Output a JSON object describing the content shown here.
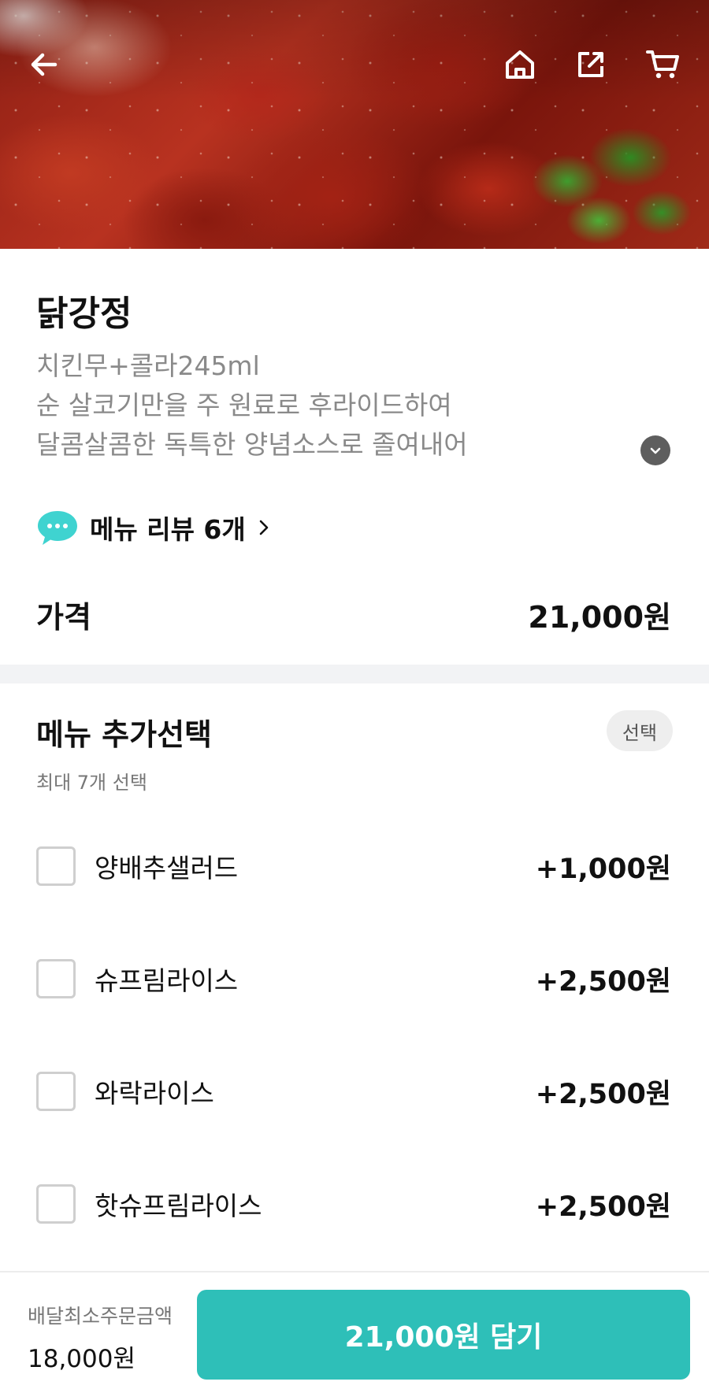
{
  "header": {
    "back_icon": "arrow-left-icon",
    "home_icon": "home-icon",
    "share_icon": "share-icon",
    "cart_icon": "cart-icon"
  },
  "menu": {
    "name": "닭강정",
    "description": [
      "치킨무+콜라245ml",
      "순 살코기만을 주 원료로 후라이드하여",
      "달콤살콤한 독특한 양념소스로 졸여내어"
    ],
    "review_label": "메뉴 리뷰 6개",
    "price_label": "가격",
    "price_value": "21,000원"
  },
  "options": {
    "title": "메뉴 추가선택",
    "badge": "선택",
    "subtitle": "최대 7개 선택",
    "items": [
      {
        "name": "양배추샐러드",
        "price": "+1,000원"
      },
      {
        "name": "슈프림라이스",
        "price": "+2,500원"
      },
      {
        "name": "와락라이스",
        "price": "+2,500원"
      },
      {
        "name": "핫슈프림라이스",
        "price": "+2,500원"
      }
    ]
  },
  "footer": {
    "min_order_label": "배달최소주문금액",
    "min_order_value": "18,000원",
    "cart_button_label": "21,000원 담기"
  },
  "colors": {
    "accent": "#2ebfb8",
    "review_bubble": "#3fd3d0",
    "divider": "#f2f3f5"
  }
}
